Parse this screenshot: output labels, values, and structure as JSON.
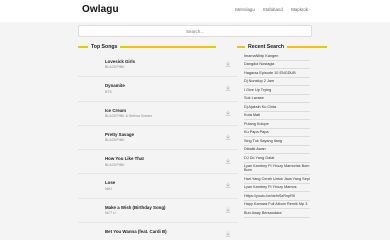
{
  "header": {
    "logo": "Owlagu",
    "nav": [
      "Metrolagu",
      "Stafaband",
      "Wapkrok"
    ]
  },
  "search": {
    "placeholder": "Search..."
  },
  "top_songs": {
    "title": "Top Songs",
    "items": [
      {
        "title": "Lovesick Girls",
        "artist": "BLACKPINK"
      },
      {
        "title": "Dynamite",
        "artist": "BTS"
      },
      {
        "title": "Ice Cream",
        "artist": "BLACKPINK & Selena Gomez"
      },
      {
        "title": "Pretty Savage",
        "artist": "BLACKPINK"
      },
      {
        "title": "How You Like That",
        "artist": "BLACKPINK"
      },
      {
        "title": "Lose",
        "artist": "NIKI"
      },
      {
        "title": "Make a Wish (Birthday Song)",
        "artist": "NCT U"
      },
      {
        "title": "Bet You Wanna (feat. Cardi B)",
        "artist": ""
      }
    ]
  },
  "recent_search": {
    "title": "Recent Search",
    "items": [
      "ImamaNibip Kangen",
      "Dangdut Nostagia",
      "Hagaraz Episode 10 ENGDUB",
      "Dj Nonstop 2 Jam",
      "I Give Up Trying",
      "Sok Lavase",
      "Dj Ajaksih Ku Cinta",
      "Kota Mati",
      "Pulang Kolope",
      "Ku Papa Papa",
      "Sing Tuk Sayang Ilang",
      "Dibalik Awan",
      "DJ Do Yang Galat",
      "Lyan Kambey Ft Yhozy Mamorisk Bom Bom",
      "Hari Yang Cerah Untuk Jiwa Yang Sepi",
      "Lyan Kambey Ft Yhozy Mamos",
      "Https://youtu.be/dzfnSzRnpR0",
      "Hapy Kamara Full Album Remik Mp 3",
      "Bun Away Bersaudara"
    ]
  },
  "colors": {
    "accent": "#f5c400",
    "background": "#f4f4f4"
  },
  "icons": {
    "download": "download-icon"
  }
}
